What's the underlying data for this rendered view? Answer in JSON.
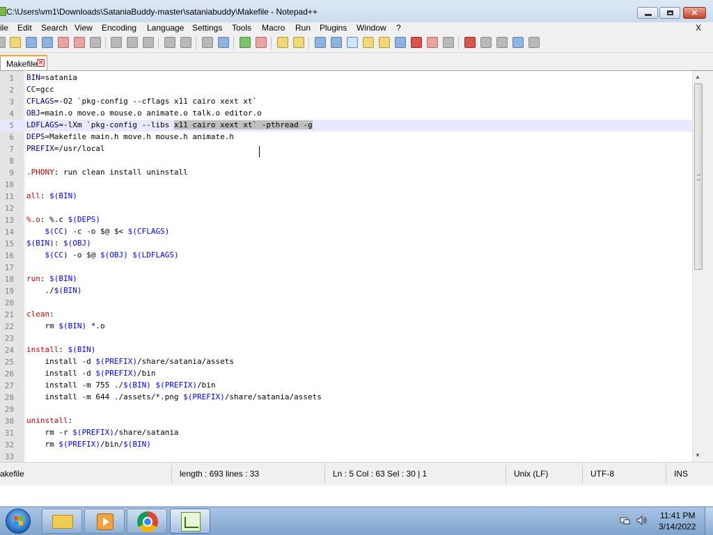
{
  "window": {
    "title": "C:\\Users\\vm1\\Downloads\\SataniaBuddy-master\\sataniabuddy\\Makefile - Notepad++",
    "min_glyph": "",
    "close_glyph": "✕"
  },
  "menu": {
    "items": [
      "ile",
      "Edit",
      "Search",
      "View",
      "Encoding",
      "Language",
      "Settings",
      "Tools",
      "Macro",
      "Run",
      "Plugins",
      "Window",
      "?"
    ],
    "close_label": "X"
  },
  "tab": {
    "label": "Makefile",
    "close_glyph": "✕"
  },
  "editor": {
    "lines": [
      {
        "n": "1",
        "code": [
          [
            "v",
            "BIN"
          ],
          [
            "o",
            "=satania"
          ]
        ]
      },
      {
        "n": "2",
        "code": [
          [
            "v",
            "CC"
          ],
          [
            "o",
            "=gcc"
          ]
        ]
      },
      {
        "n": "3",
        "code": [
          [
            "v",
            "CFLAGS"
          ],
          [
            "o",
            "=-O2 `pkg-config --cflags x11 cairo xext xt`"
          ]
        ]
      },
      {
        "n": "4",
        "code": [
          [
            "v",
            "OBJ"
          ],
          [
            "o",
            "=main.o move.o mouse.o animate.o talk.o editor.o"
          ]
        ]
      },
      {
        "n": "5",
        "current": true,
        "code": [
          [
            "v",
            "LDFLAGS"
          ],
          [
            "o",
            "=-lXm `pkg-config --libs "
          ],
          [
            "s",
            "x11 cairo xext xt` -pthread -g"
          ]
        ]
      },
      {
        "n": "6",
        "code": [
          [
            "v",
            "DEPS"
          ],
          [
            "o",
            "=Makefile main.h move.h mouse.h animate.h"
          ]
        ]
      },
      {
        "n": "7",
        "code": [
          [
            "v",
            "PREFIX"
          ],
          [
            "o",
            "=/usr/local"
          ]
        ]
      },
      {
        "n": "8",
        "code": []
      },
      {
        "n": "9",
        "code": [
          [
            "t",
            ".PHONY"
          ],
          [
            "o",
            ": run clean install uninstall"
          ]
        ]
      },
      {
        "n": "10",
        "code": []
      },
      {
        "n": "11",
        "code": [
          [
            "t",
            "all"
          ],
          [
            "o",
            ": "
          ],
          [
            "r",
            "$(BIN)"
          ]
        ]
      },
      {
        "n": "12",
        "code": []
      },
      {
        "n": "13",
        "code": [
          [
            "t",
            "%.o"
          ],
          [
            "o",
            ": %.c "
          ],
          [
            "r",
            "$(DEPS)"
          ]
        ]
      },
      {
        "n": "14",
        "code": [
          [
            "o",
            "    "
          ],
          [
            "r",
            "$(CC)"
          ],
          [
            "o",
            " -c -o $@ $< "
          ],
          [
            "r",
            "$(CFLAGS)"
          ]
        ]
      },
      {
        "n": "15",
        "code": [
          [
            "r",
            "$(BIN)"
          ],
          [
            "o",
            ": "
          ],
          [
            "r",
            "$(OBJ)"
          ]
        ]
      },
      {
        "n": "16",
        "code": [
          [
            "o",
            "    "
          ],
          [
            "r",
            "$(CC)"
          ],
          [
            "o",
            " -o $@ "
          ],
          [
            "r",
            "$(OBJ)"
          ],
          [
            "o",
            " "
          ],
          [
            "r",
            "$(LDFLAGS)"
          ]
        ]
      },
      {
        "n": "17",
        "code": []
      },
      {
        "n": "18",
        "code": [
          [
            "t",
            "run"
          ],
          [
            "o",
            ": "
          ],
          [
            "r",
            "$(BIN)"
          ]
        ]
      },
      {
        "n": "19",
        "code": [
          [
            "o",
            "    ./"
          ],
          [
            "r",
            "$(BIN)"
          ]
        ]
      },
      {
        "n": "20",
        "code": []
      },
      {
        "n": "21",
        "code": [
          [
            "t",
            "clean"
          ],
          [
            "o",
            ":"
          ]
        ]
      },
      {
        "n": "22",
        "code": [
          [
            "o",
            "    rm "
          ],
          [
            "r",
            "$(BIN)"
          ],
          [
            "o",
            " *.o"
          ]
        ]
      },
      {
        "n": "23",
        "code": []
      },
      {
        "n": "24",
        "code": [
          [
            "t",
            "install"
          ],
          [
            "o",
            ": "
          ],
          [
            "r",
            "$(BIN)"
          ]
        ]
      },
      {
        "n": "25",
        "code": [
          [
            "o",
            "    install -d "
          ],
          [
            "r",
            "$(PREFIX)"
          ],
          [
            "o",
            "/share/satania/assets"
          ]
        ]
      },
      {
        "n": "26",
        "code": [
          [
            "o",
            "    install -d "
          ],
          [
            "r",
            "$(PREFIX)"
          ],
          [
            "o",
            "/bin"
          ]
        ]
      },
      {
        "n": "27",
        "code": [
          [
            "o",
            "    install -m 755 ./"
          ],
          [
            "r",
            "$(BIN)"
          ],
          [
            "o",
            " "
          ],
          [
            "r",
            "$(PREFIX)"
          ],
          [
            "o",
            "/bin"
          ]
        ]
      },
      {
        "n": "28",
        "code": [
          [
            "o",
            "    install -m 644 ./assets/*.png "
          ],
          [
            "r",
            "$(PREFIX)"
          ],
          [
            "o",
            "/share/satania/assets"
          ]
        ]
      },
      {
        "n": "29",
        "code": []
      },
      {
        "n": "30",
        "code": [
          [
            "t",
            "uninstall"
          ],
          [
            "o",
            ":"
          ]
        ]
      },
      {
        "n": "31",
        "code": [
          [
            "o",
            "    rm -r "
          ],
          [
            "r",
            "$(PREFIX)"
          ],
          [
            "o",
            "/share/satania"
          ]
        ]
      },
      {
        "n": "32",
        "code": [
          [
            "o",
            "    rm "
          ],
          [
            "r",
            "$(PREFIX)"
          ],
          [
            "o",
            "/bin/"
          ],
          [
            "r",
            "$(BIN)"
          ]
        ]
      },
      {
        "n": "33",
        "code": []
      }
    ]
  },
  "scrollbar": {
    "up_glyph": "▲",
    "down_glyph": "▼"
  },
  "status": {
    "file_type": "akefile",
    "length_lines": "length : 693    lines : 33",
    "position": "Ln : 5    Col : 63    Sel : 30 | 1",
    "eol": "Unix (LF)",
    "encoding": "UTF-8",
    "mode": "INS"
  },
  "taskbar": {
    "time": "11:41 PM",
    "date": "3/14/2022"
  },
  "colors": {
    "keyword_var": "#000080",
    "target": "#c00000",
    "var_ref": "#0000ff",
    "current_line": "#e8e8ff",
    "selection": "#c0c0c0"
  }
}
